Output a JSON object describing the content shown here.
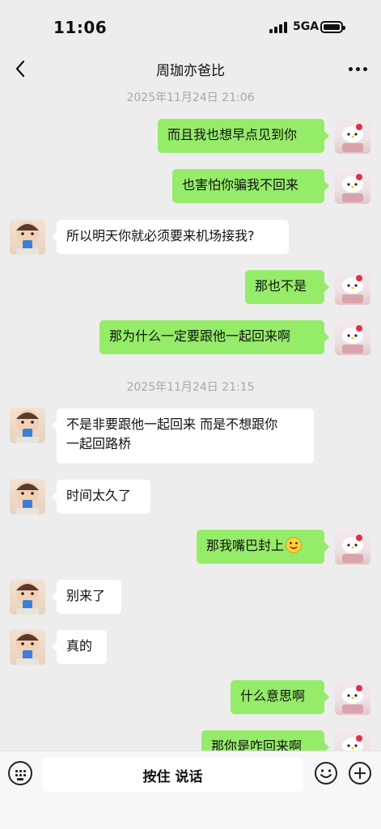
{
  "status_bar": {
    "time": "11:06",
    "network": "5GA"
  },
  "header": {
    "title": "周珈亦爸比"
  },
  "messages": [
    {
      "type": "timestamp",
      "text": "2025年11月24日 21:06"
    },
    {
      "type": "me",
      "text": "而且我也想早点见到你"
    },
    {
      "type": "me",
      "text": "也害怕你骗我不回来"
    },
    {
      "type": "other",
      "text": "所以明天你就必须要来机场接我?"
    },
    {
      "type": "me",
      "text": "那也不是"
    },
    {
      "type": "me",
      "text": "那为什么一定要跟他一起回来啊"
    },
    {
      "type": "timestamp",
      "text": "2025年11月24日 21:15"
    },
    {
      "type": "other",
      "lines": [
        "不是非要跟他一起回来 而是不想跟你",
        "一起回路桥"
      ]
    },
    {
      "type": "other",
      "text": "时间太久了"
    },
    {
      "type": "me",
      "text": "那我嘴巴封上",
      "emoji": "smile-emoji"
    },
    {
      "type": "other",
      "text": "别来了"
    },
    {
      "type": "other",
      "text": "真的"
    },
    {
      "type": "me",
      "text": "什么意思啊"
    },
    {
      "type": "me",
      "text": "那你是咋回来啊"
    }
  ],
  "input_bar": {
    "hold_to_talk": "按住 说话"
  },
  "colors": {
    "my_bubble": "#95ec69",
    "other_bubble": "#ffffff",
    "background": "#ededed"
  },
  "icons": [
    "back-chevron-icon",
    "more-icon",
    "keyboard-voice-icon",
    "emoji-icon",
    "plus-icon"
  ]
}
